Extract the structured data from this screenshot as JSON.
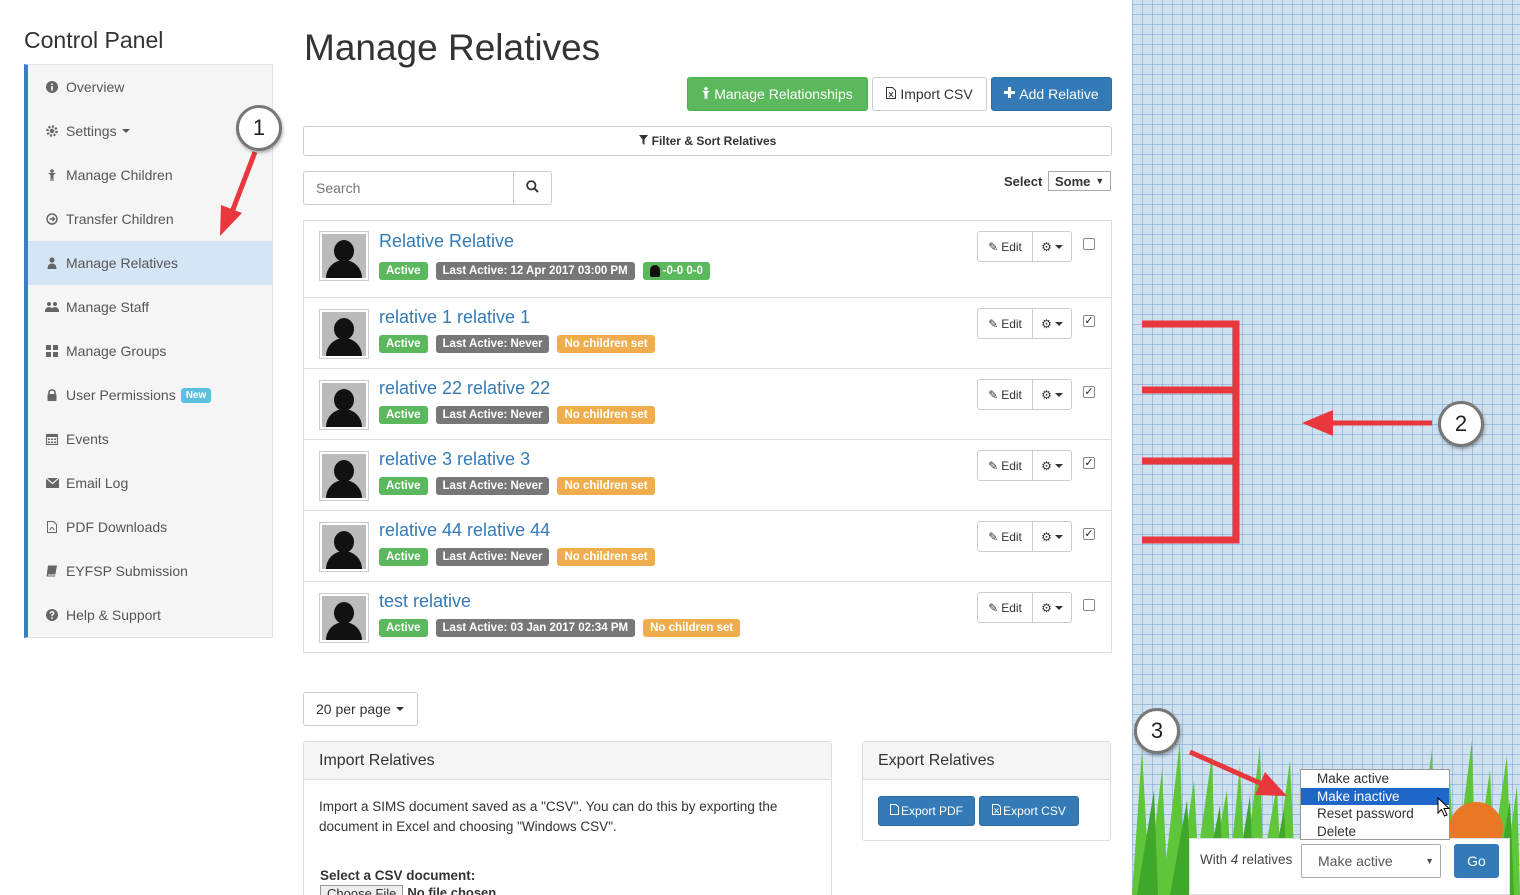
{
  "sidebar": {
    "title": "Control Panel",
    "items": [
      {
        "label": "Overview",
        "icon": "info-circle-icon"
      },
      {
        "label": "Settings",
        "icon": "gear-icon"
      },
      {
        "label": "Manage Children",
        "icon": "child-icon"
      },
      {
        "label": "Transfer Children",
        "icon": "transfer-icon"
      },
      {
        "label": "Manage Relatives",
        "icon": "user-icon"
      },
      {
        "label": "Manage Staff",
        "icon": "users-icon"
      },
      {
        "label": "Manage Groups",
        "icon": "grid-icon"
      },
      {
        "label": "User Permissions",
        "icon": "lock-icon",
        "badge": "New"
      },
      {
        "label": "Events",
        "icon": "calendar-icon"
      },
      {
        "label": "Email Log",
        "icon": "envelope-icon"
      },
      {
        "label": "PDF Downloads",
        "icon": "pdf-file-icon"
      },
      {
        "label": "EYFSP Submission",
        "icon": "book-icon"
      },
      {
        "label": "Help & Support",
        "icon": "question-circle-icon"
      }
    ]
  },
  "main": {
    "title": "Manage Relatives",
    "toolbar": {
      "manage_relationships": "Manage Relationships",
      "import_csv": "Import CSV",
      "add_relative": "Add Relative"
    },
    "filter_label": "Filter & Sort Relatives",
    "search_placeholder": "Search",
    "select_label": "Select",
    "select_value": "Some",
    "edit_label": "Edit",
    "relatives": [
      {
        "name": "Relative Relative",
        "status": "Active",
        "last_active": "Last Active: 12 Apr 2017 03:00 PM",
        "extra": "-0-0 0-0",
        "checked": false
      },
      {
        "name": "relative 1 relative 1",
        "status": "Active",
        "last_active": "Last Active: Never",
        "extra": "No children set",
        "checked": true
      },
      {
        "name": "relative 22 relative 22",
        "status": "Active",
        "last_active": "Last Active: Never",
        "extra": "No children set",
        "checked": true
      },
      {
        "name": "relative 3 relative 3",
        "status": "Active",
        "last_active": "Last Active: Never",
        "extra": "No children set",
        "checked": true
      },
      {
        "name": "relative 44 relative 44",
        "status": "Active",
        "last_active": "Last Active: Never",
        "extra": "No children set",
        "checked": true
      },
      {
        "name": "test relative",
        "status": "Active",
        "last_active": "Last Active: 03 Jan 2017 02:34 PM",
        "extra": "No children set",
        "checked": false
      }
    ],
    "per_page": "20 per page",
    "import_panel": {
      "title": "Import Relatives",
      "text": "Import a SIMS document saved as a \"CSV\". You can do this by exporting the document in Excel and choosing \"Windows CSV\".",
      "csv_label": "Select a CSV document:",
      "file_button": "Choose File",
      "file_status": "No file chosen"
    },
    "export_panel": {
      "title": "Export Relatives",
      "export_pdf": "Export PDF",
      "export_csv": "Export CSV"
    }
  },
  "bulk": {
    "prefix": "With",
    "count": "4",
    "suffix": "relatives",
    "selected": "Make active",
    "options": [
      "Make active",
      "Make inactive",
      "Reset password",
      "Delete"
    ],
    "highlighted": 1,
    "go": "Go"
  },
  "callouts": [
    "1",
    "2",
    "3"
  ],
  "colors": {
    "primary": "#337ab7",
    "success": "#5cb85c",
    "warning": "#f0ad4e",
    "arrow": "#e8383d"
  }
}
